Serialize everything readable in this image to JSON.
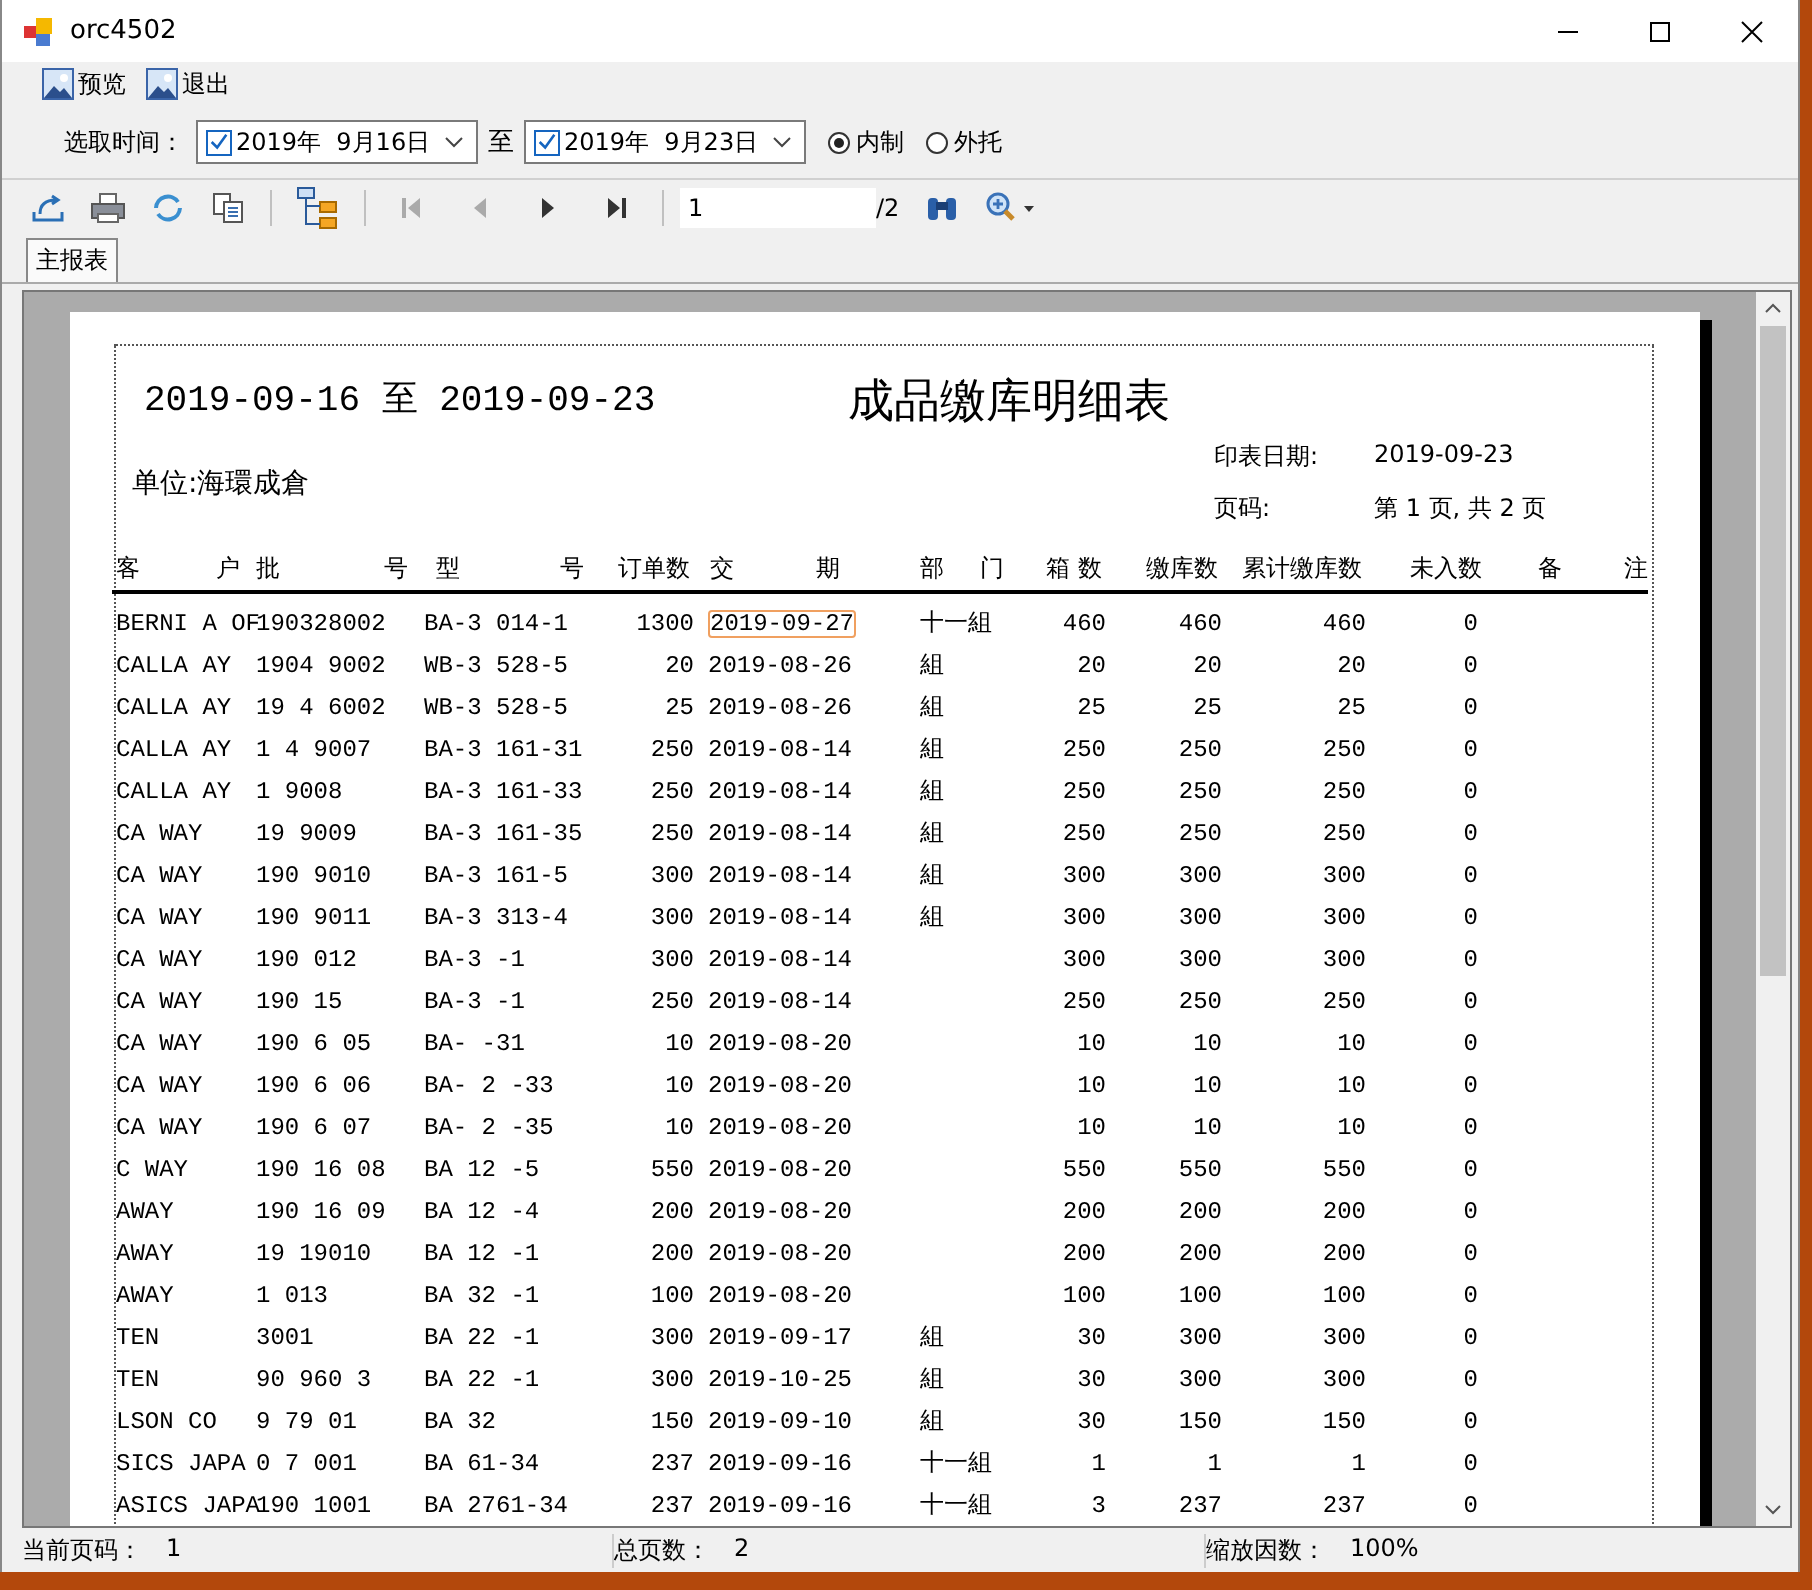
{
  "window": {
    "title": "orc4502"
  },
  "menu": [
    {
      "label": "预览"
    },
    {
      "label": "退出"
    }
  ],
  "filter": {
    "label": "选取时间：",
    "from": {
      "value": "2019年  9月16日",
      "checked": true
    },
    "separator": "至",
    "to": {
      "value": "2019年  9月23日",
      "checked": true
    },
    "options": [
      {
        "label": "内制",
        "selected": true
      },
      {
        "label": "外托",
        "selected": false
      }
    ]
  },
  "viewer_toolbar": {
    "page": "1",
    "total": "/2",
    "nav": [
      {
        "kind": "first",
        "disabled": true
      },
      {
        "kind": "prev",
        "disabled": true
      },
      {
        "kind": "next",
        "disabled": false
      },
      {
        "kind": "last",
        "disabled": false
      }
    ]
  },
  "tabs": [
    {
      "label": "主报表",
      "selected": true
    }
  ],
  "report": {
    "period": "2019-09-16 至 2019-09-23",
    "title": "成品缴库明细表",
    "unit": "单位:海環成倉",
    "print_date_label": "印表日期:",
    "print_date": "2019-09-23",
    "page_label": "页码:",
    "page_info": "第 1 页, 共 2 页",
    "columns": [
      "客 户",
      "批 号",
      "型 号",
      "订单数",
      "交 期",
      "部 门",
      "箱 数",
      "缴库数",
      "累计缴库数",
      "未入数",
      "备 注"
    ],
    "rows": [
      {
        "customer": "BERNI A OF",
        "batch": "190328002",
        "model": "BA-3 014-1",
        "qty": "1300",
        "due": "2019-09-27",
        "dept": "十一組",
        "boxes": "460",
        "stocked": "460",
        "cumulative": "460",
        "pending": "0",
        "focused": true
      },
      {
        "customer": "CALLA AY",
        "batch": "1904 9002",
        "model": "WB-3 528-5",
        "qty": "20",
        "due": "2019-08-26",
        "dept": "組",
        "boxes": "20",
        "stocked": "20",
        "cumulative": "20",
        "pending": "0",
        "focused": false
      },
      {
        "customer": "CALLA AY",
        "batch": "19 4 6002",
        "model": "WB-3 528-5",
        "qty": "25",
        "due": "2019-08-26",
        "dept": "組",
        "boxes": "25",
        "stocked": "25",
        "cumulative": "25",
        "pending": "0",
        "focused": false
      },
      {
        "customer": "CALLA AY",
        "batch": "1 4 9007",
        "model": "BA-3 161-31",
        "qty": "250",
        "due": "2019-08-14",
        "dept": "組",
        "boxes": "250",
        "stocked": "250",
        "cumulative": "250",
        "pending": "0",
        "focused": false
      },
      {
        "customer": "CALLA AY",
        "batch": "1 9008",
        "model": "BA-3 161-33",
        "qty": "250",
        "due": "2019-08-14",
        "dept": "組",
        "boxes": "250",
        "stocked": "250",
        "cumulative": "250",
        "pending": "0",
        "focused": false
      },
      {
        "customer": "CA WAY",
        "batch": "19 9009",
        "model": "BA-3 161-35",
        "qty": "250",
        "due": "2019-08-14",
        "dept": "組",
        "boxes": "250",
        "stocked": "250",
        "cumulative": "250",
        "pending": "0",
        "focused": false
      },
      {
        "customer": "CA WAY",
        "batch": "190 9010",
        "model": "BA-3 161-5",
        "qty": "300",
        "due": "2019-08-14",
        "dept": "組",
        "boxes": "300",
        "stocked": "300",
        "cumulative": "300",
        "pending": "0",
        "focused": false
      },
      {
        "customer": "CA WAY",
        "batch": "190 9011",
        "model": "BA-3 313-4",
        "qty": "300",
        "due": "2019-08-14",
        "dept": "組",
        "boxes": "300",
        "stocked": "300",
        "cumulative": "300",
        "pending": "0",
        "focused": false
      },
      {
        "customer": "CA WAY",
        "batch": "190 012",
        "model": "BA-3 -1",
        "qty": "300",
        "due": "2019-08-14",
        "boxes": "300",
        "stocked": "300",
        "cumulative": "300",
        "pending": "0",
        "focused": false
      },
      {
        "customer": "CA WAY",
        "batch": "190 15",
        "model": "BA-3 -1",
        "qty": "250",
        "due": "2019-08-14",
        "boxes": "250",
        "stocked": "250",
        "cumulative": "250",
        "pending": "0",
        "focused": false
      },
      {
        "customer": "CA WAY",
        "batch": "190 6 05",
        "model": "BA- -31",
        "qty": "10",
        "due": "2019-08-20",
        "boxes": "10",
        "stocked": "10",
        "cumulative": "10",
        "pending": "0",
        "focused": false
      },
      {
        "customer": "CA WAY",
        "batch": "190 6 06",
        "model": "BA- 2 -33",
        "qty": "10",
        "due": "2019-08-20",
        "boxes": "10",
        "stocked": "10",
        "cumulative": "10",
        "pending": "0",
        "focused": false
      },
      {
        "customer": "CA WAY",
        "batch": "190 6 07",
        "model": "BA- 2 -35",
        "qty": "10",
        "due": "2019-08-20",
        "boxes": "10",
        "stocked": "10",
        "cumulative": "10",
        "pending": "0",
        "focused": false
      },
      {
        "customer": "C WAY",
        "batch": "190 16 08",
        "model": "BA 12 -5",
        "qty": "550",
        "due": "2019-08-20",
        "boxes": "550",
        "stocked": "550",
        "cumulative": "550",
        "pending": "0",
        "focused": false
      },
      {
        "customer": "AWAY",
        "batch": "190 16 09",
        "model": "BA 12 -4",
        "qty": "200",
        "due": "2019-08-20",
        "boxes": "200",
        "stocked": "200",
        "cumulative": "200",
        "pending": "0",
        "focused": false
      },
      {
        "customer": "AWAY",
        "batch": "19 19010",
        "model": "BA 12 -1",
        "qty": "200",
        "due": "2019-08-20",
        "boxes": "200",
        "stocked": "200",
        "cumulative": "200",
        "pending": "0",
        "focused": false
      },
      {
        "customer": "AWAY",
        "batch": "1 013",
        "model": "BA 32 -1",
        "qty": "100",
        "due": "2019-08-20",
        "boxes": "100",
        "stocked": "100",
        "cumulative": "100",
        "pending": "0",
        "focused": false
      },
      {
        "customer": "TEN",
        "batch": "3001",
        "model": "BA 22 -1",
        "qty": "300",
        "due": "2019-09-17",
        "dept": "組",
        "boxes": "30",
        "stocked": "300",
        "cumulative": "300",
        "pending": "0",
        "focused": false
      },
      {
        "customer": "TEN",
        "batch": "90 960 3",
        "model": "BA 22 -1",
        "qty": "300",
        "due": "2019-10-25",
        "dept": "組",
        "boxes": "30",
        "stocked": "300",
        "cumulative": "300",
        "pending": "0",
        "focused": false
      },
      {
        "customer": "LSON CO",
        "batch": "9 79 01",
        "model": "BA 32",
        "qty": "150",
        "due": "2019-09-10",
        "dept": "組",
        "boxes": "30",
        "stocked": "150",
        "cumulative": "150",
        "pending": "0",
        "focused": false
      },
      {
        "customer": "SICS JAPA",
        "batch": "0 7 001",
        "model": "BA 61-34",
        "qty": "237",
        "due": "2019-09-16",
        "dept": "十一組",
        "boxes": "1",
        "stocked": "1",
        "cumulative": "1",
        "pending": "0",
        "focused": false
      },
      {
        "customer": "ASICS JAPA",
        "batch": "190 1001",
        "model": "BA 2761-34",
        "qty": "237",
        "due": "2019-09-16",
        "dept": "十一組",
        "boxes": "3",
        "stocked": "237",
        "cumulative": "237",
        "pending": "0",
        "focused": false
      }
    ]
  },
  "status_bar": [
    {
      "label": "当前页码：",
      "value": "1"
    },
    {
      "label": "总页数：",
      "value": "2"
    },
    {
      "label": "缩放因数：",
      "value": "100%"
    }
  ]
}
